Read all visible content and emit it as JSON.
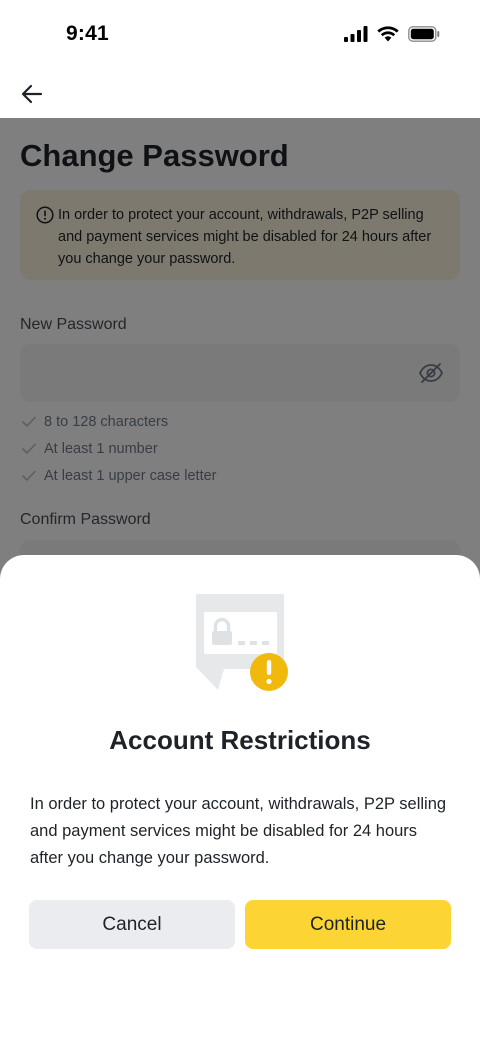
{
  "status_bar": {
    "time": "9:41"
  },
  "page": {
    "title": "Change Password",
    "warning": "In order to protect your account, withdrawals, P2P selling and payment services might be disabled for 24 hours after you change your password.",
    "new_password": {
      "label": "New Password",
      "value": ""
    },
    "rules": [
      "8 to 128 characters",
      "At least 1 number",
      "At least 1 upper case letter"
    ],
    "confirm_password": {
      "label": "Confirm Password"
    }
  },
  "dialog": {
    "title": "Account Restrictions",
    "body": "In order to protect your account, withdrawals, P2P selling and payment services might be disabled for 24 hours after you change your password.",
    "cancel_label": "Cancel",
    "continue_label": "Continue"
  },
  "colors": {
    "accent": "#FCD535",
    "warning_bg": "#FCF3DD",
    "text_primary": "#1E2329",
    "icon_badge": "#F0B90B"
  },
  "icons": {
    "back": "arrow-left-icon",
    "warning": "info-circle-icon",
    "eye": "eye-off-icon",
    "check": "check-icon",
    "illustration": "lock-alert-icon"
  }
}
